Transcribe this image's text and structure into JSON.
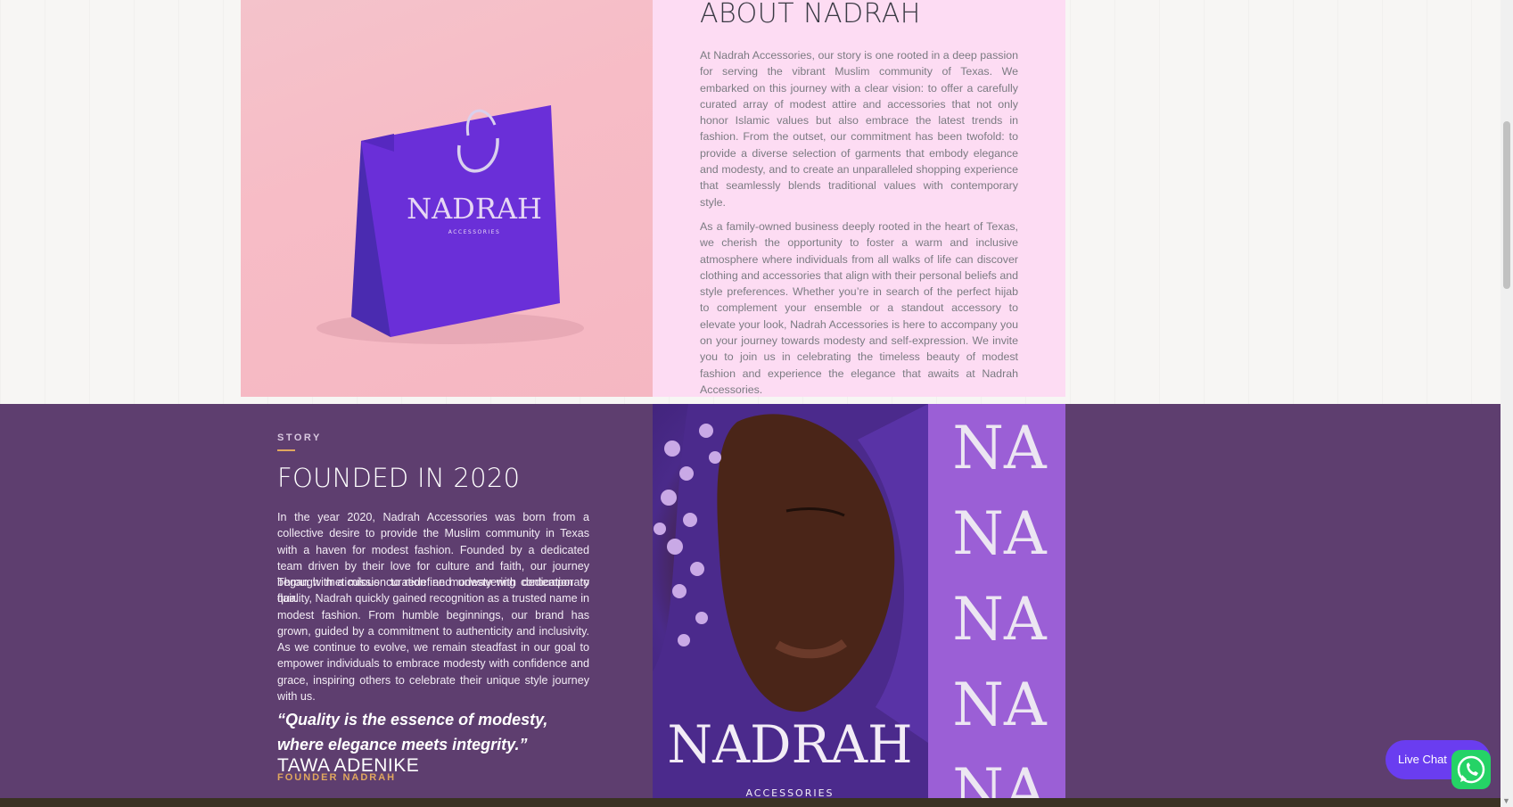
{
  "colors": {
    "about_panel_bg": "#fddcf3",
    "story_bg": "#5e3e6f",
    "accent_gold": "#e0a75e",
    "brand_purple": "#9b5fd6",
    "live_chat_bg": "#6a3df0",
    "whatsapp_green": "#25d366"
  },
  "about": {
    "title": "ABOUT NADRAH",
    "paragraphs": [
      "At Nadrah Accessories, our story is one rooted in a deep passion for serving the vibrant Muslim community of Texas. We embarked on this journey with a clear vision: to offer a carefully curated array of modest attire and accessories that not only honor Islamic values but also embrace the latest trends in fashion. From the outset, our commitment has been twofold: to provide a diverse selection of garments that embody elegance and modesty, and to create an unparalleled shopping experience that seamlessly blends traditional values with contemporary style.",
      "As a family-owned business deeply rooted in the heart of Texas, we cherish the opportunity to foster a warm and inclusive atmosphere where individuals from all walks of life can discover clothing and accessories that align with their personal beliefs and style preferences. Whether you’re in search of the perfect hijab to complement your ensemble or a standout accessory to elevate your look, Nadrah Accessories is here to accompany you on your journey towards modesty and self-expression. We invite you to join us in celebrating the timeless beauty of modest fashion and experience the elegance that awaits at Nadrah Accessories."
    ],
    "bag_logo": "NADRAH",
    "bag_logo_sub": "ACCESSORIES"
  },
  "story": {
    "label": "STORY",
    "title": "FOUNDED IN 2020",
    "paragraphs": [
      "In the year 2020, Nadrah Accessories was born from a collective desire to provide the Muslim community in Texas with a haven for modest fashion. Founded by a dedicated team driven by their love for culture and faith, our journey began with a mission to redefine modesty with contemporary flair.",
      "Through meticulous curation and unwavering dedication to quality, Nadrah quickly gained recognition as a trusted name in modest fashion. From humble beginnings, our brand has grown, guided by a commitment to authenticity and inclusivity. As we continue to evolve, we remain steadfast in our goal to empower individuals to embrace modesty with confidence and grace, inspiring others to celebrate their unique style journey with us."
    ],
    "quote": "“Quality is the essence of modesty, where elegance meets integrity.”",
    "founder_name": "TAWA ADENIKE",
    "founder_role": "FOUNDER NADRAH",
    "image_logo": "NADRAH",
    "image_logo_sub": "ACCESSORIES",
    "pattern_monogram": "NA"
  },
  "widgets": {
    "live_chat_label": "Live Chat",
    "whatsapp_icon": "whatsapp-icon"
  }
}
